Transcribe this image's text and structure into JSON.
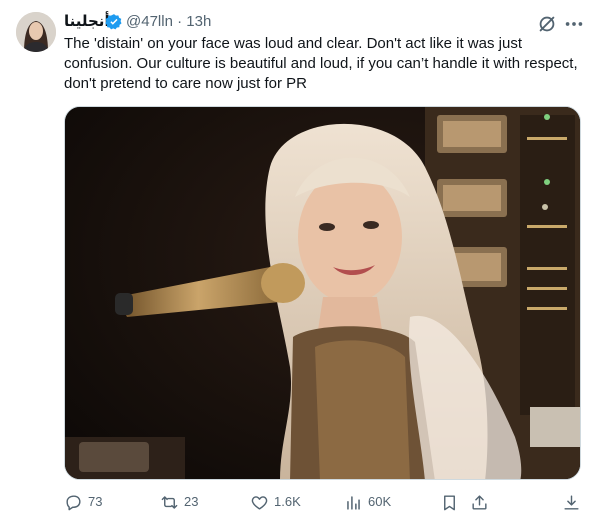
{
  "post": {
    "display_name": "أنجلينا",
    "handle": "@47lln",
    "separator": "·",
    "time": "13h",
    "text": "The 'distain' on your face was loud and clear. Don't act like it was just confusion. Our culture is beautiful and loud, if you can’t handle it with respect, don't pretend to care now just for PR"
  },
  "icons": {
    "verified": "verified-badge-icon",
    "grok": "grok-icon",
    "more": "more-icon",
    "reply": "reply-icon",
    "repost": "repost-icon",
    "like": "like-icon",
    "views": "views-icon",
    "bookmark": "bookmark-icon",
    "share": "share-icon"
  },
  "actions": {
    "replies": "73",
    "reposts": "23",
    "likes": "1.6K",
    "views": "60K"
  },
  "colors": {
    "text": "#0f1419",
    "secondary": "#536471",
    "verified": "#1d9bf0",
    "border": "#cfd9de"
  }
}
